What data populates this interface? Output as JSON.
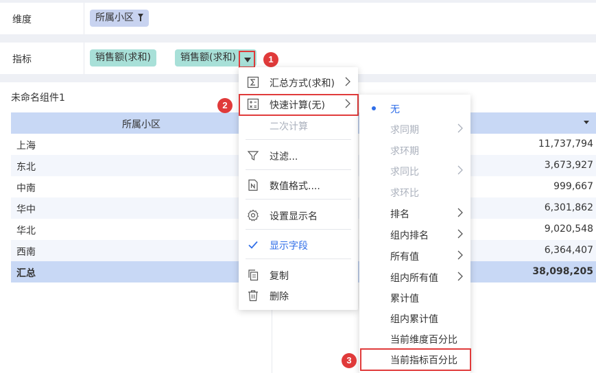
{
  "dimension_bar": {
    "label": "维度",
    "field": "所属小区"
  },
  "indicator_bar": {
    "label": "指标",
    "fields": [
      "销售额(求和)",
      "销售额(求和)"
    ]
  },
  "widget": {
    "title": "未命名组件1"
  },
  "table": {
    "header": "所属小区",
    "rows": [
      {
        "region": "上海",
        "value": "11,737,794"
      },
      {
        "region": "东北",
        "value": "3,673,927"
      },
      {
        "region": "中南",
        "value": "999,667"
      },
      {
        "region": "华中",
        "value": "6,301,862"
      },
      {
        "region": "华北",
        "value": "9,020,548"
      },
      {
        "region": "西南",
        "value": "6,364,407"
      }
    ],
    "total": {
      "label": "汇总",
      "value": "38,098,205"
    }
  },
  "field_menu": {
    "summary": "汇总方式(求和)",
    "quick_calc": "快速计算(无)",
    "secondary_calc": "二次计算",
    "filter": "过滤...",
    "number_format": "数值格式....",
    "display_name": "设置显示名",
    "show_field": "显示字段",
    "copy": "复制",
    "delete": "删除"
  },
  "quick_calc_menu": {
    "none": "无",
    "yoy": "求同期",
    "mom": "求环期",
    "yoy_ratio": "求同比",
    "mom_ratio": "求环比",
    "rank": "排名",
    "group_rank": "组内排名",
    "all_values": "所有值",
    "group_all_values": "组内所有值",
    "cumulative": "累计值",
    "group_cumulative": "组内累计值",
    "dim_percent": "当前维度百分比",
    "ind_percent": "当前指标百分比"
  },
  "badges": [
    "1",
    "2",
    "3"
  ],
  "colors": {
    "accent": "#2f6ee8",
    "highlight": "#e03a3a",
    "dimension_pill": "#c8d3f0",
    "measure_pill": "#a8e0d8",
    "table_header": "#c8d8f5"
  }
}
